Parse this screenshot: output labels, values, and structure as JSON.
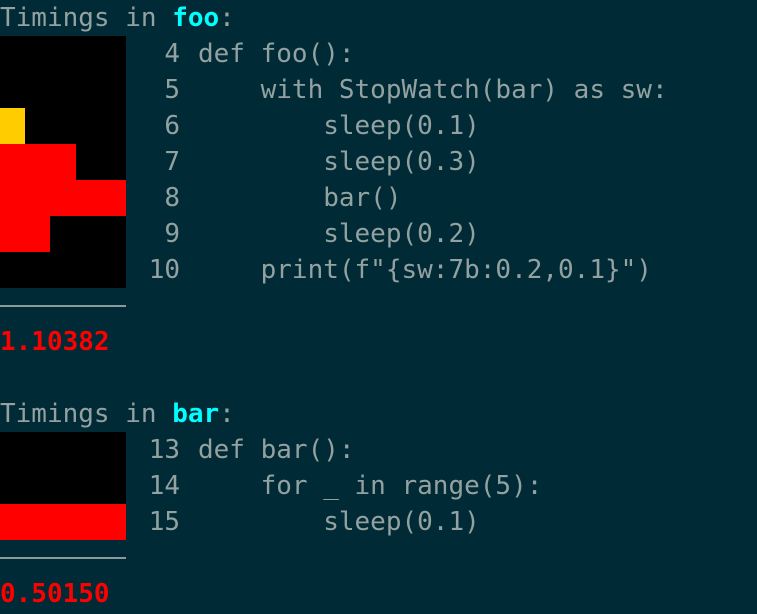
{
  "colors": {
    "background": "#002b36",
    "text": "#93a1a1",
    "function_name": "#00ffff",
    "timing_high": "#ff0000",
    "timing_low": "#ffcc00",
    "timeline_bg": "#000000"
  },
  "blocks": [
    {
      "header_prefix": "Timings in ",
      "function": "foo",
      "header_suffix": ":",
      "code": [
        {
          "no": "4",
          "text": "def foo():",
          "timing": {
            "level": 0.0,
            "color": "none"
          }
        },
        {
          "no": "5",
          "text": "    with StopWatch(bar) as sw:",
          "timing": {
            "level": 0.0,
            "color": "none"
          }
        },
        {
          "no": "6",
          "text": "        sleep(0.1)",
          "timing": {
            "level": 0.2,
            "color": "#ffcc00"
          }
        },
        {
          "no": "7",
          "text": "        sleep(0.3)",
          "timing": {
            "level": 0.6,
            "color": "#ff0000"
          }
        },
        {
          "no": "8",
          "text": "        bar()",
          "timing": {
            "level": 1.0,
            "color": "#ff0000"
          }
        },
        {
          "no": "9",
          "text": "        sleep(0.2)",
          "timing": {
            "level": 0.4,
            "color": "#ff0000"
          }
        },
        {
          "no": "10",
          "text": "    print(f\"{sw:7b:0.2,0.1}\")",
          "timing": {
            "level": 0.0,
            "color": "none"
          }
        }
      ],
      "total": "1.10382"
    },
    {
      "header_prefix": "Timings in ",
      "function": "bar",
      "header_suffix": ":",
      "code": [
        {
          "no": "13",
          "text": "def bar():",
          "timing": {
            "level": 0.0,
            "color": "none"
          }
        },
        {
          "no": "14",
          "text": "    for _ in range(5):",
          "timing": {
            "level": 0.0,
            "color": "none"
          }
        },
        {
          "no": "15",
          "text": "        sleep(0.1)",
          "timing": {
            "level": 1.0,
            "color": "#ff0000"
          }
        }
      ],
      "total": "0.50150"
    }
  ]
}
